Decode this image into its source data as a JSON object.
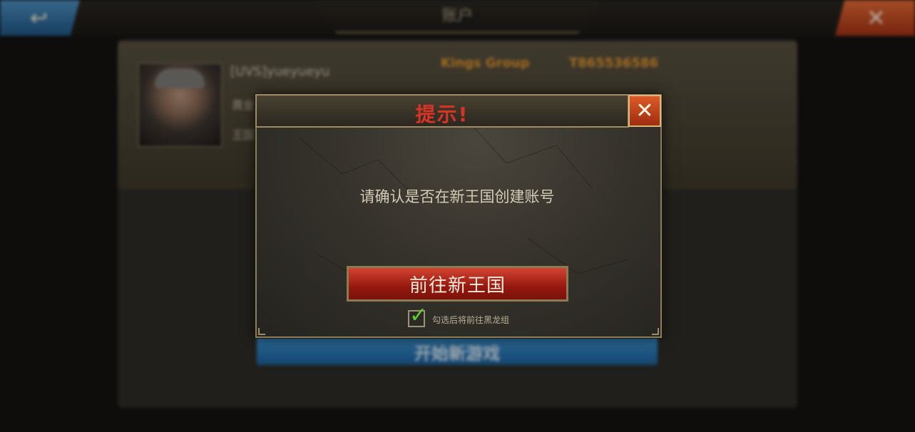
{
  "background": {
    "top_title": "账户",
    "account": {
      "name": "[UVS]yueyueyu",
      "line_1": "黄金",
      "line_2": "王国",
      "group_name": "Kings Group",
      "group_id": "T865536586"
    },
    "new_game_button": "开始新游戏"
  },
  "dialog": {
    "title": "提示!",
    "message": "请确认是否在新王国创建账号",
    "confirm_button": "前往新王国",
    "checkbox": {
      "checked": true,
      "label": "勾选后将前往黑龙组"
    }
  },
  "colors": {
    "title_red": "#d93226",
    "button_red": "#95180e",
    "check_green": "#5ecb2e",
    "accent_orange": "#e0942c",
    "accent_blue": "#1c5f99"
  }
}
